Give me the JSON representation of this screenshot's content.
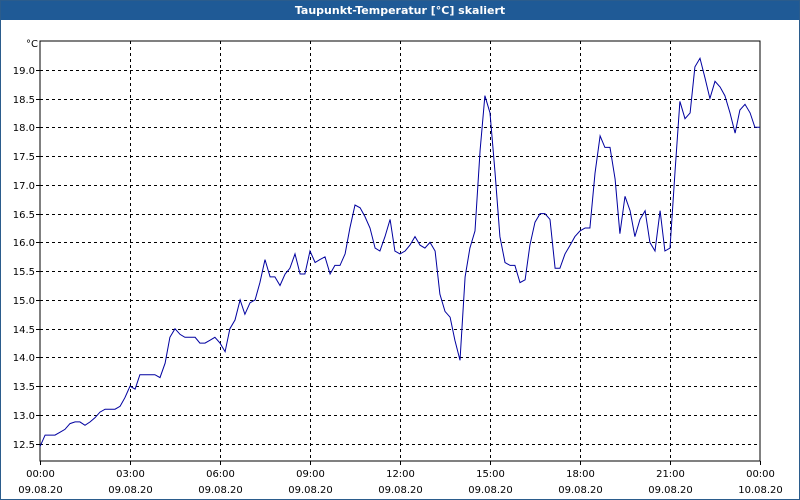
{
  "chart_data": {
    "type": "line",
    "title": "Taupunkt-Temperatur [°C] skaliert",
    "ylabel": "°C",
    "xlabel": "",
    "ylim": [
      12.2,
      19.5
    ],
    "yticks": [
      12.5,
      13.0,
      13.5,
      14.0,
      14.5,
      15.0,
      15.5,
      16.0,
      16.5,
      17.0,
      17.5,
      18.0,
      18.5,
      19.0
    ],
    "ytick_labels": [
      "12.5",
      "13.0",
      "13.5",
      "14.0",
      "14.5",
      "15.0",
      "15.5",
      "16.0",
      "16.5",
      "17.0",
      "17.5",
      "18.0",
      "18.5",
      "19.0"
    ],
    "xlim": [
      0,
      24
    ],
    "xticks": [
      0,
      3,
      6,
      9,
      12,
      15,
      18,
      21,
      24
    ],
    "xtick_time_labels": [
      "00:00",
      "03:00",
      "06:00",
      "09:00",
      "12:00",
      "15:00",
      "18:00",
      "21:00",
      "00:00"
    ],
    "xtick_date_labels": [
      "09.08.20",
      "09.08.20",
      "09.08.20",
      "09.08.20",
      "09.08.20",
      "09.08.20",
      "09.08.20",
      "09.08.20",
      "10.08.20"
    ],
    "grid": true,
    "line_color": "#0000a0",
    "series": [
      {
        "x": [
          0.0,
          0.17,
          0.33,
          0.5,
          0.67,
          0.83,
          1.0,
          1.17,
          1.33,
          1.5,
          1.67,
          1.83,
          2.0,
          2.17,
          2.33,
          2.5,
          2.67,
          2.83,
          3.0,
          3.17,
          3.33,
          3.5,
          3.67,
          3.83,
          4.0,
          4.17,
          4.33,
          4.5,
          4.67,
          4.83,
          5.0,
          5.17,
          5.33,
          5.5,
          5.67,
          5.83,
          6.0,
          6.17,
          6.33,
          6.5,
          6.67,
          6.83,
          7.0,
          7.17,
          7.33,
          7.5,
          7.67,
          7.83,
          8.0,
          8.17,
          8.33,
          8.5,
          8.67,
          8.83,
          9.0,
          9.17,
          9.33,
          9.5,
          9.67,
          9.83,
          10.0,
          10.17,
          10.33,
          10.5,
          10.67,
          10.83,
          11.0,
          11.17,
          11.33,
          11.5,
          11.67,
          11.83,
          12.0,
          12.17,
          12.33,
          12.5,
          12.67,
          12.83,
          13.0,
          13.17,
          13.33,
          13.5,
          13.67,
          13.83,
          14.0,
          14.17,
          14.33,
          14.5,
          14.67,
          14.83,
          15.0,
          15.17,
          15.33,
          15.5,
          15.67,
          15.83,
          16.0,
          16.17,
          16.33,
          16.5,
          16.67,
          16.83,
          17.0,
          17.17,
          17.33,
          17.5,
          17.67,
          17.83,
          18.0,
          18.17,
          18.33,
          18.5,
          18.67,
          18.83,
          19.0,
          19.17,
          19.33,
          19.5,
          19.67,
          19.83,
          20.0,
          20.17,
          20.33,
          20.5,
          20.67,
          20.83,
          21.0,
          21.17,
          21.33,
          21.5,
          21.67,
          21.83,
          22.0,
          22.17,
          22.33,
          22.5,
          22.67,
          22.83,
          23.0,
          23.17,
          23.33,
          23.5,
          23.67,
          23.83,
          24.0
        ],
        "y": [
          12.45,
          12.65,
          12.65,
          12.65,
          12.7,
          12.75,
          12.85,
          12.88,
          12.88,
          12.82,
          12.88,
          12.95,
          13.05,
          13.1,
          13.1,
          13.1,
          13.15,
          13.3,
          13.5,
          13.45,
          13.7,
          13.7,
          13.7,
          13.7,
          13.65,
          13.9,
          14.35,
          14.5,
          14.4,
          14.35,
          14.35,
          14.35,
          14.25,
          14.25,
          14.3,
          14.35,
          14.25,
          14.1,
          14.5,
          14.65,
          15.0,
          14.75,
          14.95,
          15.0,
          15.3,
          15.7,
          15.4,
          15.4,
          15.25,
          15.45,
          15.55,
          15.8,
          15.45,
          15.45,
          15.85,
          15.65,
          15.7,
          15.75,
          15.45,
          15.6,
          15.6,
          15.8,
          16.25,
          16.65,
          16.6,
          16.45,
          16.25,
          15.9,
          15.85,
          16.1,
          16.4,
          15.85,
          15.8,
          15.85,
          15.95,
          16.1,
          15.95,
          15.9,
          16.0,
          15.85,
          15.1,
          14.8,
          14.7,
          14.3,
          13.95,
          15.4,
          15.9,
          16.2,
          17.6,
          18.55,
          18.25,
          17.2,
          16.1,
          15.65,
          15.6,
          15.6,
          15.3,
          15.35,
          15.95,
          16.35,
          16.5,
          16.5,
          16.4,
          15.55,
          15.55,
          15.8,
          15.95,
          16.1,
          16.2,
          16.25,
          16.25,
          17.2,
          17.85,
          17.65,
          17.65,
          17.1,
          16.15,
          16.8,
          16.55,
          16.1,
          16.4,
          16.55,
          16.0,
          15.85,
          16.55,
          15.85,
          15.9,
          17.25,
          18.45,
          18.15,
          18.25,
          19.05,
          19.2,
          18.85,
          18.5,
          18.8,
          18.7,
          18.55,
          18.25,
          17.9,
          18.3,
          18.4,
          18.25,
          18.0,
          18.0
        ]
      }
    ]
  }
}
